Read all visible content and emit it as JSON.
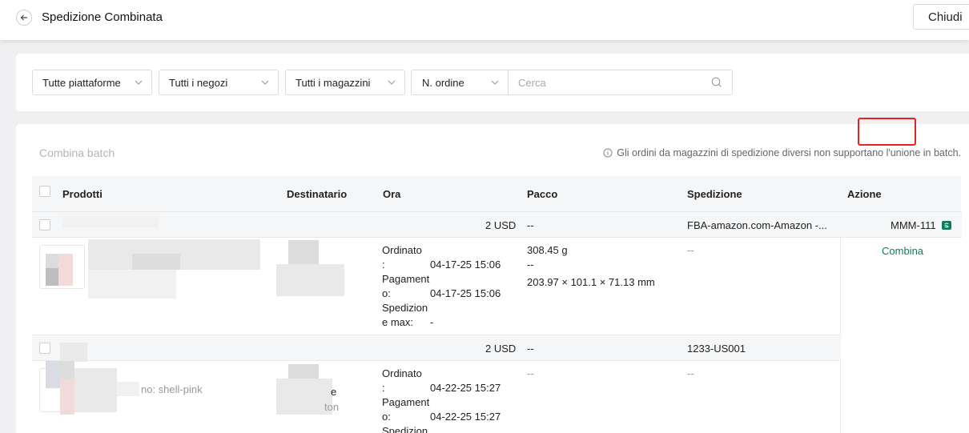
{
  "header": {
    "title": "Spedizione Combinata",
    "close_label": "Chiudi"
  },
  "filters": {
    "platform": "Tutte piattaforme",
    "shop": "Tutti i negozi",
    "warehouse": "Tutti i magazzini",
    "order_field": "N. ordine",
    "search_placeholder": "Cerca"
  },
  "list": {
    "batch_label": "Combina batch",
    "notice": "Gli ordini da magazzini di spedizione diversi non supportano l'unione in batch.",
    "columns": [
      "Prodotti",
      "Destinatario",
      "Ora",
      "Pacco",
      "Spedizione",
      "Azione"
    ],
    "groups": [
      {
        "amount": "2 USD",
        "package": "--",
        "shipping": "FBA-amazon.com-Amazon -...",
        "action_label": "MMM-111",
        "order": {
          "ordinato_label_a": "Ordinato",
          "ordinato_label_b": ":",
          "ordinato_value": "04-17-25 15:06",
          "pagamento_label_a": "Pagament",
          "pagamento_label_b": "o:",
          "pagamento_value": "04-17-25 15:06",
          "spedizione_label_a": "Spedizion",
          "spedizione_label_b": "e max:",
          "spedizione_value": "-",
          "weight": "308.45 g",
          "package_extra": "--",
          "dimensions": "203.97 × 101.1 × 71.13 mm",
          "shipping_value": "--",
          "action_link": "Combina"
        }
      },
      {
        "amount": "2 USD",
        "package": "--",
        "shipping": "1233-US001",
        "order": {
          "product_partial": "no: shell-pink",
          "recipient_partial_1": "e",
          "recipient_partial_2": "ton",
          "ordinato_label_a": "Ordinato",
          "ordinato_label_b": ":",
          "ordinato_value": "04-22-25 15:27",
          "pagamento_label_a": "Pagament",
          "pagamento_label_b": "o:",
          "pagamento_value": "04-22-25 15:27",
          "spedizione_label_a": "Spedizion",
          "package_value": "--",
          "shipping_value": "--"
        }
      }
    ]
  },
  "colors": {
    "accent_green": "#137a5e",
    "highlight_red": "#e8221e"
  }
}
